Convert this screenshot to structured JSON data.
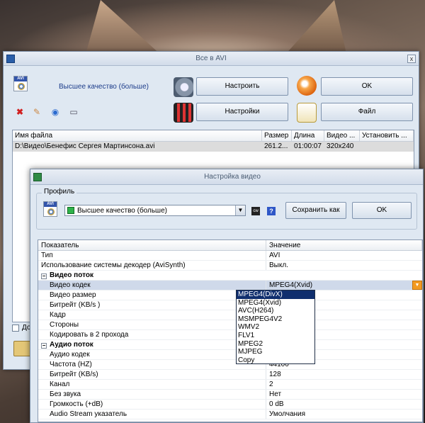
{
  "main_window": {
    "title": "Все в AVI",
    "close_glyph": "x",
    "profile_label": "Высшее качество (больше)",
    "buttons": {
      "configure": "Настроить",
      "ok": "OK",
      "settings": "Настройки",
      "file": "Файл"
    },
    "toolbar_icons": [
      "delete-icon",
      "clear-icon",
      "refresh-icon",
      "properties-icon"
    ],
    "file_list": {
      "columns": [
        "Имя файла",
        "Размер",
        "Длина",
        "Видео ...",
        "Установить ..."
      ],
      "rows": [
        {
          "name": "D:\\Видео\\Бенефис Сергея Мартинсона.avi",
          "size": "261.2...",
          "length": "01:00:07",
          "video": "320x240",
          "set": ""
        }
      ]
    },
    "bottom_checkbox_label": "До"
  },
  "video_dialog": {
    "title": "Настройка видео",
    "profile_group_label": "Профиль",
    "profile_value": "Высшее качество (больше)",
    "combo_arrow": "▼",
    "save_as": "Сохранить как",
    "ok": "OK",
    "help_glyph": "?",
    "grid_headers": [
      "Показатель",
      "Значение"
    ],
    "rows": [
      {
        "k": "Тип",
        "v": "AVI",
        "type": "plain"
      },
      {
        "k": "Использование системы декодер (AviSynth)",
        "v": "Выкл.",
        "type": "plain"
      },
      {
        "k": "Видео поток",
        "v": "",
        "type": "section",
        "exp": "−"
      },
      {
        "k": "Видео кодек",
        "v": "MPEG4(Xvid)",
        "type": "indent",
        "selected": true
      },
      {
        "k": "Видео размер",
        "v": "",
        "type": "indent"
      },
      {
        "k": "Битрейт (KB/s )",
        "v": "",
        "type": "indent"
      },
      {
        "k": "Кадр",
        "v": "",
        "type": "indent"
      },
      {
        "k": "Стороны",
        "v": "",
        "type": "indent"
      },
      {
        "k": "Кодировать в 2 прохода",
        "v": "",
        "type": "indent"
      },
      {
        "k": "Аудио поток",
        "v": "",
        "type": "section",
        "exp": "−"
      },
      {
        "k": "Аудио кодек",
        "v": "",
        "type": "indent"
      },
      {
        "k": "Частота (HZ)",
        "v": "44100",
        "type": "indent"
      },
      {
        "k": "Битрейт (KB/s)",
        "v": "128",
        "type": "indent"
      },
      {
        "k": "Канал",
        "v": "2",
        "type": "indent"
      },
      {
        "k": "Без звука",
        "v": "Нет",
        "type": "indent"
      },
      {
        "k": "Громкость (+dB)",
        "v": "0 dB",
        "type": "indent"
      },
      {
        "k": "Audio Stream указатель",
        "v": "Умолчания",
        "type": "indent"
      }
    ],
    "codec_dropdown": {
      "arrow": "▼",
      "options": [
        "MPEG4(DivX)",
        "MPEG4(Xvid)",
        "AVC(H264)",
        "MSMPEG4V2",
        "WMV2",
        "FLV1",
        "MPEG2",
        "MJPEG",
        "Copy"
      ],
      "highlighted": "MPEG4(DivX)"
    }
  }
}
